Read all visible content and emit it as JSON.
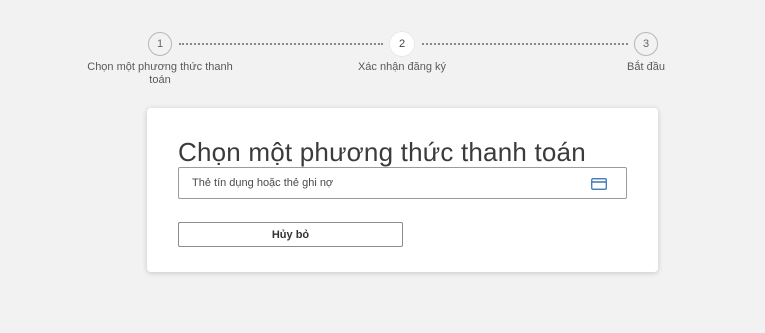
{
  "stepper": {
    "steps": [
      {
        "number": "1",
        "label": "Chọn một phương thức thanh toán"
      },
      {
        "number": "2",
        "label": "Xác nhận đăng ký"
      },
      {
        "number": "3",
        "label": "Bắt đầu"
      }
    ],
    "active_step": 2
  },
  "card": {
    "title": "Chọn một phương thức thanh toán",
    "payment_option": {
      "label": "Thẻ tín dụng hoặc thẻ ghi nợ",
      "icon": "credit-card-icon"
    },
    "cancel_label": "Hủy bỏ"
  },
  "colors": {
    "page_background": "#f2f2f2",
    "card_background": "#ffffff",
    "icon_accent": "#2b6cb0"
  }
}
